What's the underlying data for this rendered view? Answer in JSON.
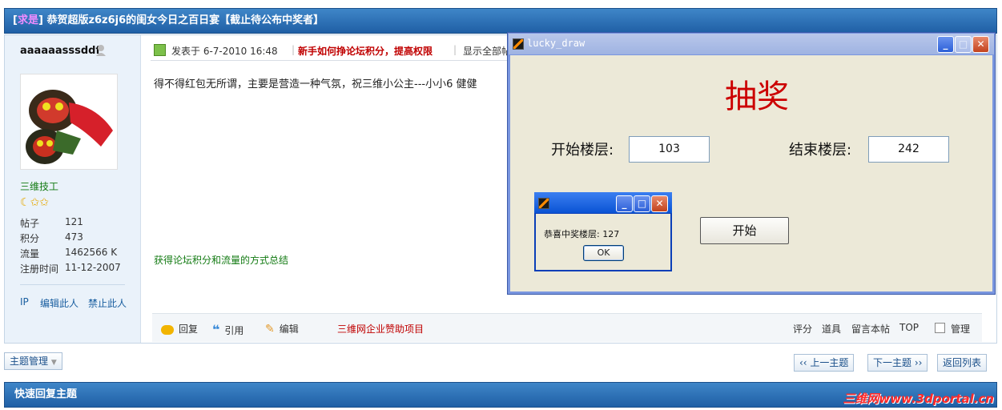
{
  "thread": {
    "tag": "求是",
    "title": "恭贺超版z6z6j6的闺女今日之百日宴【截止待公布中奖者】"
  },
  "author": {
    "username": "aaaaaasssddf",
    "rank": "三维技工",
    "stats": [
      {
        "label": "帖子",
        "value": "121"
      },
      {
        "label": "积分",
        "value": "473"
      },
      {
        "label": "流量",
        "value": "1462566 K"
      },
      {
        "label": "注册时间",
        "value": "11-12-2007"
      }
    ],
    "links": [
      "IP",
      "编辑此人",
      "禁止此人"
    ]
  },
  "post": {
    "posted_at": "发表于  6-7-2010 16:48",
    "tip_link": "新手如何挣论坛积分，提高权限",
    "show_all": "显示全部帖",
    "body": "得不得红包无所谓，主要是营造一种气氛，祝三维小公主---小小6 健健",
    "footer_link": "获得论坛积分和流量的方式总结"
  },
  "actions": {
    "reply": "回复",
    "quote": "引用",
    "edit": "编辑",
    "sponsor": "三维网企业赞助项目",
    "rate": "评分",
    "props": "道具",
    "message": "留言本帖",
    "top": "TOP",
    "manage": "管理"
  },
  "toolbar": {
    "topic_manage": "主题管理",
    "prev": "‹‹ 上一主题",
    "next": "下一主题 ››",
    "back": "返回列表"
  },
  "quick_reply": "快速回复主题",
  "watermark": "三维网www.3dportal.cn",
  "dialog": {
    "title": "lucky_draw",
    "heading": "抽奖",
    "start_floor_label": "开始楼层:",
    "start_floor_value": "103",
    "end_floor_label": "结束楼层:",
    "end_floor_value": "242",
    "start_button": "开始"
  },
  "message_box": {
    "text": "恭喜中奖楼层: 127",
    "ok": "OK"
  },
  "colors": {
    "header_blue": "#2f72b8",
    "dialog_bg": "#ece9d8",
    "heading_red": "#cc0000"
  }
}
